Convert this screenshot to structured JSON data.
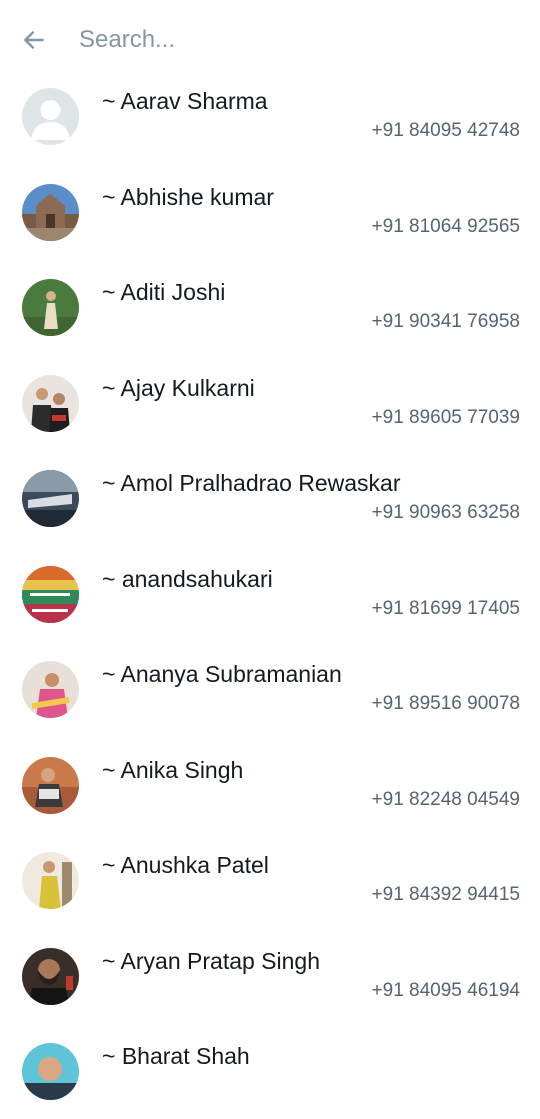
{
  "header": {
    "back_icon": "arrow-left-icon",
    "search_placeholder": "Search..."
  },
  "contacts": [
    {
      "name": "~ Aarav Sharma",
      "phone": "+91 84095 42748",
      "avatar": "default-person-icon"
    },
    {
      "name": "~ Abhishe kumar",
      "phone": "+91 81064 92565",
      "avatar": "photo"
    },
    {
      "name": "~ Aditi Joshi",
      "phone": "+91 90341 76958",
      "avatar": "photo"
    },
    {
      "name": "~ Ajay Kulkarni",
      "phone": "+91 89605 77039",
      "avatar": "photo"
    },
    {
      "name": "~ Amol Pralhadrao Rewaskar",
      "phone": "+91 90963 63258",
      "avatar": "photo"
    },
    {
      "name": "~ anandsahukari",
      "phone": "+91 81699 17405",
      "avatar": "photo"
    },
    {
      "name": "~ Ananya Subramanian",
      "phone": "+91 89516 90078",
      "avatar": "photo"
    },
    {
      "name": "~ Anika Singh",
      "phone": "+91 82248 04549",
      "avatar": "photo"
    },
    {
      "name": "~ Anushka Patel",
      "phone": "+91 84392 94415",
      "avatar": "photo"
    },
    {
      "name": "~ Aryan Pratap Singh",
      "phone": "+91 84095 46194",
      "avatar": "photo"
    },
    {
      "name": "~ Bharat Shah",
      "phone": "",
      "avatar": "photo"
    }
  ]
}
